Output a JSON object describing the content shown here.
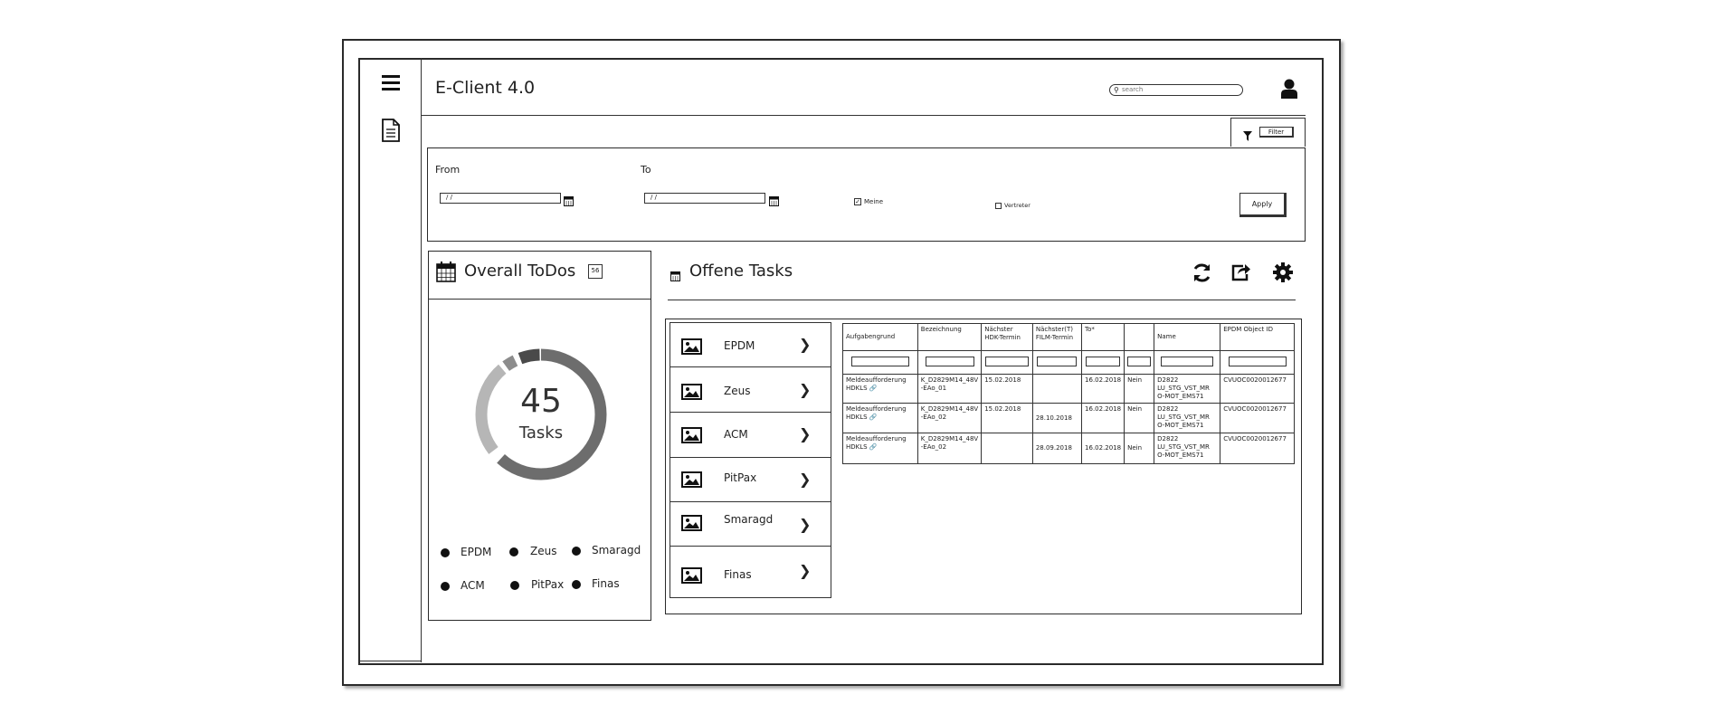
{
  "app": {
    "title": "E-Client 4.0"
  },
  "search": {
    "placeholder": "search"
  },
  "toolbar": {
    "filter_label": "Filter"
  },
  "filters": {
    "from_label": "From",
    "to_label": "To",
    "from_value": "/ /",
    "to_value": "/ /",
    "meine_label": "Meine",
    "meine_checked": true,
    "vertreter_label": "Vertreter",
    "vertreter_checked": false,
    "apply_label": "Apply"
  },
  "todos": {
    "title": "Overall ToDos",
    "badge": "56",
    "total": "45",
    "unit": "Tasks",
    "legend": [
      "EPDM",
      "Zeus",
      "Smaragd",
      "ACM",
      "PitPax",
      "Finas"
    ]
  },
  "tasks": {
    "title": "Offene Tasks",
    "systems": [
      "EPDM",
      "Zeus",
      "ACM",
      "PitPax",
      "Smaragd",
      "Finas"
    ],
    "columns": [
      "Aufgabengrund",
      "Bezeichnung",
      "Nächster HDK-Termin",
      "Nächster(T) FILM-Termin",
      "To*",
      "",
      "Name",
      "EPDM Object ID"
    ],
    "rows": [
      [
        "Meldeaufforderung HDKLS",
        "K_D2829M14_48V -EAo_01",
        "15.02.2018",
        "",
        "16.02.2018",
        "Nein",
        "D2822 LU_STG_VST_MR O-MOT_EMS71",
        "CVUOC0020012677"
      ],
      [
        "Meldeaufforderung HDKLS",
        "K_D2829M14_48V -EAo_02",
        "15.02.2018",
        "28.10.2018",
        "16.02.2018",
        "Nein",
        "D2822 LU_STG_VST_MR O-MOT_EMS71",
        "CVUOC0020012677"
      ],
      [
        "Meldeaufforderung HDKLS",
        "K_D2829M14_48V -EAo_02",
        "",
        "28.09.2018",
        "16.02.2018",
        "Nein",
        "D2822 LU_STG_VST_MR O-MOT_EMS71",
        "CVUOC0020012677"
      ]
    ]
  }
}
